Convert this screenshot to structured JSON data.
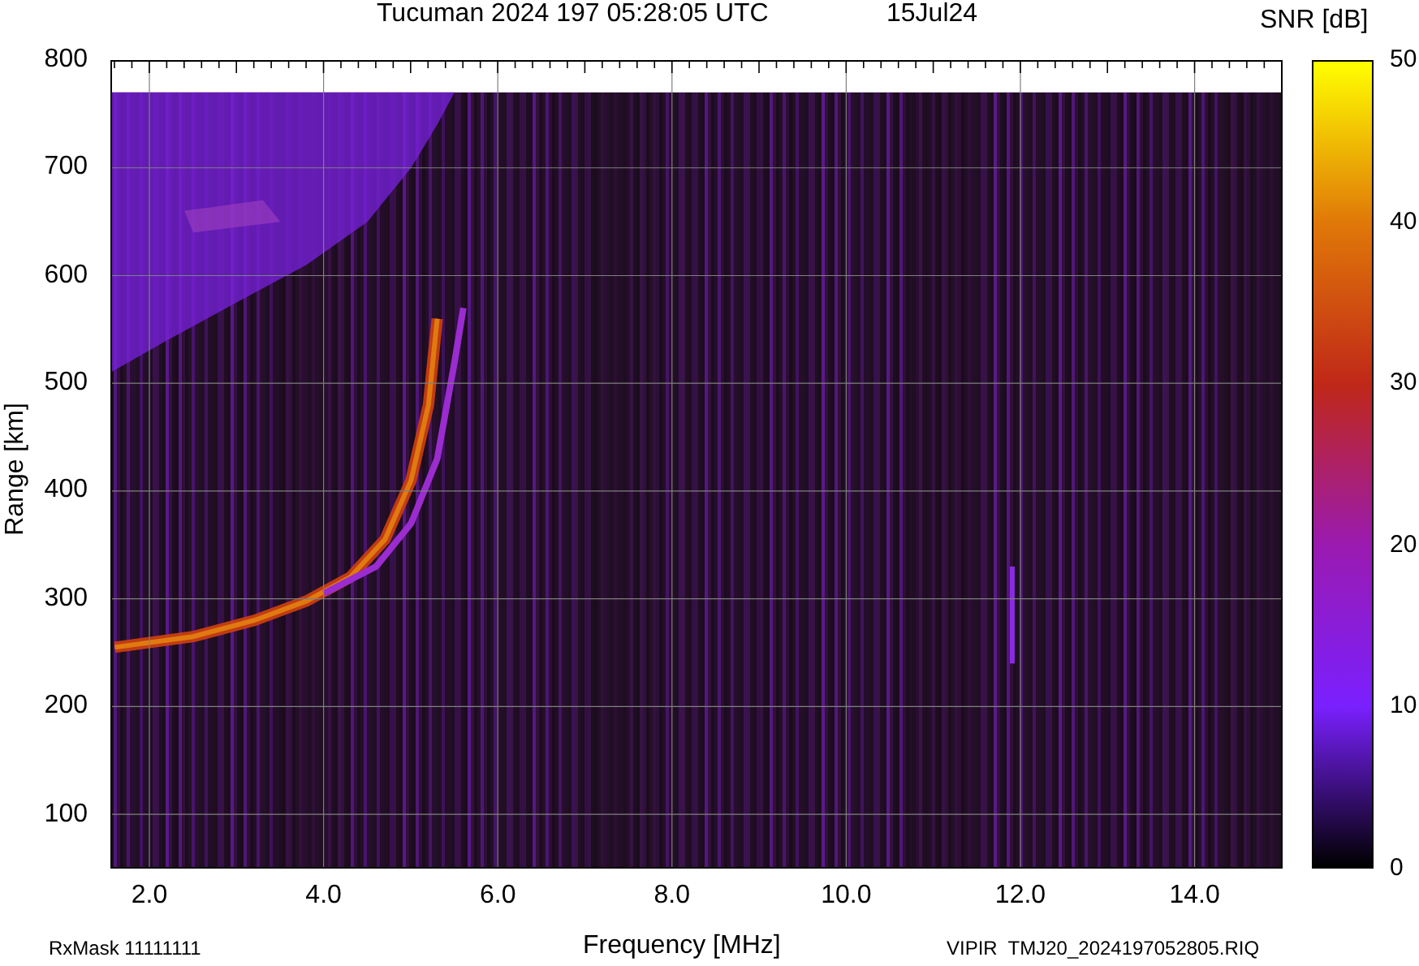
{
  "title": {
    "station": "Tucuman 2024 197 05:28:05 UTC",
    "date": "15Jul24"
  },
  "plot": {
    "ylabel": "Range [km]",
    "xlabel": "Frequency [MHz]",
    "yticks": [
      "800",
      "700",
      "600",
      "500",
      "400",
      "300",
      "200",
      "100"
    ],
    "xticks": [
      "2.0",
      "4.0",
      "6.0",
      "8.0",
      "10.0",
      "12.0",
      "14.0"
    ]
  },
  "colorbar": {
    "label": "SNR [dB]",
    "ticks": [
      "50",
      "40",
      "30",
      "20",
      "10",
      "0"
    ]
  },
  "footer": {
    "left": "RxMask 11111111",
    "right": "VIPIR  TMJ20_2024197052805.RIQ"
  }
}
